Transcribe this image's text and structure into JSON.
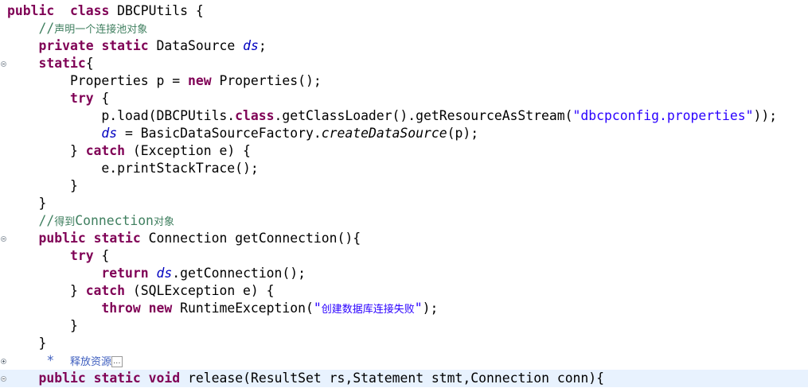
{
  "editor": {
    "lines": [
      {
        "segments": [
          [
            "kw",
            "public"
          ],
          [
            "",
            "  "
          ],
          [
            "kw",
            "class"
          ],
          [
            "",
            " DBCPUtils {"
          ]
        ]
      },
      {
        "segments": [
          [
            "",
            "    "
          ],
          [
            "cm",
            "//声明一个连接池对象"
          ]
        ]
      },
      {
        "segments": [
          [
            "",
            "    "
          ],
          [
            "kw",
            "private"
          ],
          [
            "",
            " "
          ],
          [
            "kw",
            "static"
          ],
          [
            "",
            " DataSource "
          ],
          [
            "fld",
            "ds"
          ],
          [
            "",
            ";"
          ]
        ]
      },
      {
        "segments": [
          [
            "",
            "    "
          ],
          [
            "kw",
            "static"
          ],
          [
            "",
            "{"
          ]
        ]
      },
      {
        "segments": [
          [
            "",
            "        Properties p = "
          ],
          [
            "kw",
            "new"
          ],
          [
            "",
            " Properties();"
          ]
        ]
      },
      {
        "segments": [
          [
            "",
            "        "
          ],
          [
            "kw",
            "try"
          ],
          [
            "",
            " {"
          ]
        ]
      },
      {
        "segments": [
          [
            "",
            "            p.load(DBCPUtils."
          ],
          [
            "kw",
            "class"
          ],
          [
            "",
            ".getClassLoader().getResourceAsStream("
          ],
          [
            "st",
            "\"dbcpconfig.properties\""
          ],
          [
            "",
            "));"
          ]
        ]
      },
      {
        "segments": [
          [
            "",
            "            "
          ],
          [
            "fld",
            "ds"
          ],
          [
            "",
            " = BasicDataSourceFactory."
          ],
          [
            "it",
            "createDataSource"
          ],
          [
            "",
            "(p);"
          ]
        ]
      },
      {
        "segments": [
          [
            "",
            "        } "
          ],
          [
            "kw",
            "catch"
          ],
          [
            "",
            " (Exception e) {"
          ]
        ]
      },
      {
        "segments": [
          [
            "",
            "            e.printStackTrace();"
          ]
        ]
      },
      {
        "segments": [
          [
            "",
            "        }"
          ]
        ]
      },
      {
        "segments": [
          [
            "",
            "    }"
          ]
        ]
      },
      {
        "segments": [
          [
            "",
            "    "
          ],
          [
            "cm",
            "//得到Connection对象"
          ]
        ]
      },
      {
        "segments": [
          [
            "",
            "    "
          ],
          [
            "kw",
            "public"
          ],
          [
            "",
            " "
          ],
          [
            "kw",
            "static"
          ],
          [
            "",
            " Connection getConnection(){"
          ]
        ]
      },
      {
        "segments": [
          [
            "",
            "        "
          ],
          [
            "kw",
            "try"
          ],
          [
            "",
            " {"
          ]
        ]
      },
      {
        "segments": [
          [
            "",
            "            "
          ],
          [
            "kw",
            "return"
          ],
          [
            "",
            " "
          ],
          [
            "fld",
            "ds"
          ],
          [
            "",
            ".getConnection();"
          ]
        ]
      },
      {
        "segments": [
          [
            "",
            "        } "
          ],
          [
            "kw",
            "catch"
          ],
          [
            "",
            " (SQLException e) {"
          ]
        ]
      },
      {
        "segments": [
          [
            "",
            "            "
          ],
          [
            "kw",
            "throw"
          ],
          [
            "",
            " "
          ],
          [
            "kw",
            "new"
          ],
          [
            "",
            " RuntimeException("
          ],
          [
            "st",
            "\"创建数据库连接失败\""
          ],
          [
            "",
            ");"
          ]
        ]
      },
      {
        "segments": [
          [
            "",
            "        }"
          ]
        ]
      },
      {
        "segments": [
          [
            "",
            "    }"
          ]
        ]
      },
      {
        "segments": [
          [
            "",
            "     "
          ],
          [
            "jd",
            "*"
          ],
          [
            "",
            "  "
          ],
          [
            "jd",
            "释放资源"
          ],
          [
            "box",
            "..."
          ]
        ]
      },
      {
        "segments": [
          [
            "",
            "    "
          ],
          [
            "kw",
            "public"
          ],
          [
            "",
            " "
          ],
          [
            "kw",
            "static"
          ],
          [
            "",
            " "
          ],
          [
            "kw",
            "void"
          ],
          [
            "",
            " release(ResultSet rs,Statement stmt,Connection conn){"
          ]
        ]
      }
    ],
    "folds": [
      {
        "line": 3,
        "kind": "collapse"
      },
      {
        "line": 13,
        "kind": "collapse"
      },
      {
        "line": 20,
        "kind": "expand"
      },
      {
        "line": 21,
        "kind": "collapse"
      }
    ],
    "current_line": 21
  }
}
